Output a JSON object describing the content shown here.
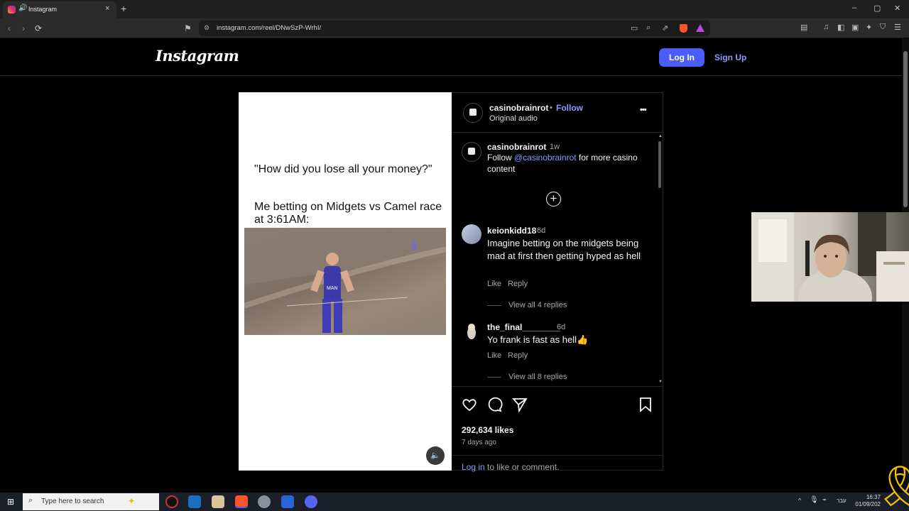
{
  "browser": {
    "tab_title": "Instagram",
    "tab_close": "×",
    "new_tab": "+",
    "url": "instagram.com/reel/DNwSzP-WrhI/",
    "window_controls": [
      "–",
      "▢",
      "✕"
    ]
  },
  "instagram": {
    "logo": "Instagram",
    "login_label": "Log In",
    "signup_label": "Sign Up"
  },
  "post": {
    "caption_quote": "\"How did you lose all your money?\"",
    "caption_main": "Me betting on Midgets vs Camel race at 3:61AM:",
    "jersey_text": "MAN",
    "author": "casinobrainrot",
    "follow_label": "Follow",
    "separator": "•",
    "audio": "Original audio",
    "more_icon": "•••",
    "description": {
      "username": "casinobrainrot",
      "time": "1w",
      "prefix": "Follow ",
      "mention": "@casinobrainrot",
      "suffix": " for more casino content"
    },
    "add_icon": "+",
    "comments": [
      {
        "username": "keionkidd18",
        "time": "6d",
        "text": "Imagine betting on the midgets being mad at first then getting hyped as hell",
        "like_label": "Like",
        "reply_label": "Reply",
        "view_replies": "View all 4 replies"
      },
      {
        "username": "the_final________",
        "time": "6d",
        "text": "Yo frank is fast as hell👍",
        "like_label": "Like",
        "reply_label": "Reply",
        "view_replies": "View all 8 replies"
      }
    ],
    "likes": "292,634 likes",
    "posted": "7 days ago",
    "login_link": "Log in",
    "login_suffix": " to like or comment."
  },
  "taskbar": {
    "search_placeholder": "Type here to search",
    "time": "16:37",
    "date": "01/09/202",
    "lang": "עבר"
  },
  "colors": {
    "accent_blue": "#4a5df9",
    "link_blue": "#8c9bff",
    "ribbon_yellow": "#f5c400"
  }
}
